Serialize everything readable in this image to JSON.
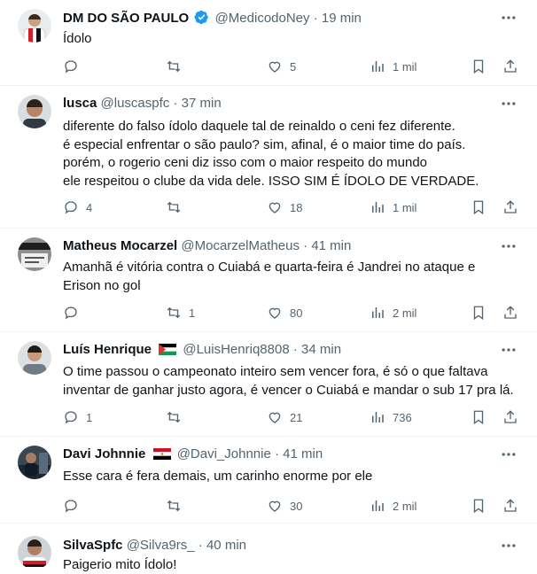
{
  "tweets": [
    {
      "name": "DM DO SÃO PAULO",
      "verified": true,
      "handle": "@MedicodoNey",
      "time": "19 min",
      "lines": [
        "Ídolo"
      ],
      "replies": "",
      "retweets": "",
      "likes": "5",
      "views": "1 mil"
    },
    {
      "name": "lusca",
      "handle": "@luscaspfc",
      "time": "37 min",
      "lines": [
        "diferente do falso ídolo daquele tal de reinaldo o ceni fez diferente.",
        "é especial enfrentar o são paulo? sim, afinal, é o maior time do país.",
        "porém, o rogerio ceni diz isso com o maior respeito do mundo",
        "ele respeitou o clube da vida dele. ISSO SIM É ÍDOLO DE VERDADE."
      ],
      "replies": "4",
      "retweets": "",
      "likes": "18",
      "views": "1 mil"
    },
    {
      "name": "Matheus Mocarzel",
      "handle": "@MocarzelMatheus",
      "time": "41 min",
      "lines": [
        "Amanhã é vitória contra o Cuiabá e quarta-feira é Jandrei no ataque e",
        "Erison no gol"
      ],
      "replies": "",
      "retweets": "1",
      "likes": "80",
      "views": "2 mil"
    },
    {
      "name": "Luís Henrique",
      "flag": "palestine",
      "handle": "@LuisHenriq8808",
      "time": "34 min",
      "lines": [
        "O time passou o campeonato inteiro sem vencer fora, é só o que faltava",
        "inventar de ganhar justo agora, é vencer o Cuiabá e mandar o sub 17 pra lá."
      ],
      "replies": "1",
      "retweets": "",
      "likes": "21",
      "views": "736"
    },
    {
      "name": "Davi Johnnie",
      "flag": "egypt",
      "handle": "@Davi_Johnnie",
      "time": "41 min",
      "lines": [
        "Esse cara é fera demais, um carinho enorme por ele"
      ],
      "replies": "",
      "retweets": "",
      "likes": "30",
      "views": "2 mil"
    },
    {
      "name": "SilvaSpfc",
      "handle": "@Silva9rs_",
      "time": "40 min",
      "lines": [
        "Paigerio mito Ídolo!"
      ],
      "replies": "",
      "retweets": "",
      "likes": "",
      "views": ""
    }
  ],
  "separator": "·",
  "colors": {
    "text": "#0f1419",
    "secondary": "#536471",
    "verified": "#1d9bf0",
    "divider": "#eff3f4"
  },
  "icons": [
    "reply-icon",
    "retweet-icon",
    "like-icon",
    "views-icon",
    "bookmark-icon",
    "share-icon",
    "more-icon",
    "verified-badge-icon"
  ]
}
